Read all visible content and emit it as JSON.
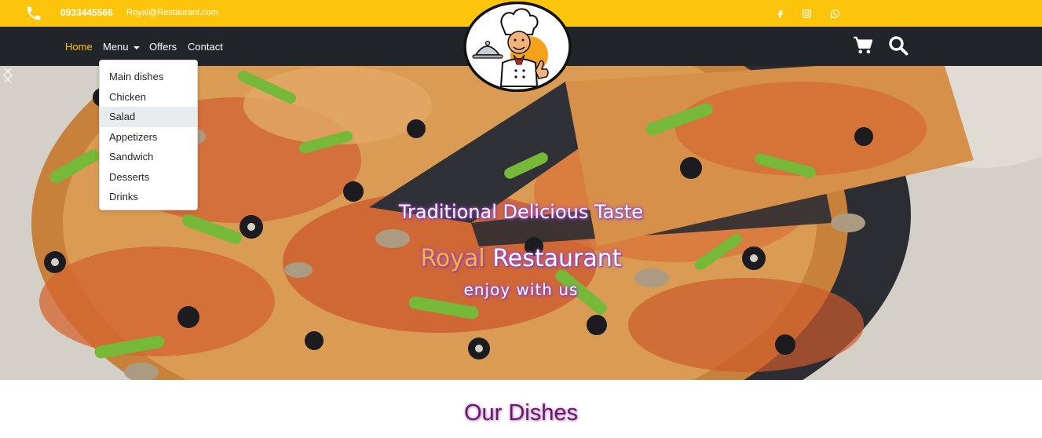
{
  "topbar": {
    "phone": "0933445566",
    "email": "Royal@Restaurant.com",
    "icons": [
      "phone-icon",
      "facebook-icon",
      "instagram-icon",
      "whatsapp-icon"
    ]
  },
  "nav": {
    "home": "Home",
    "menu": "Menu",
    "offers": "Offers",
    "contact": "Contact",
    "icons": [
      "cart-icon",
      "search-icon"
    ]
  },
  "dropdown": {
    "items": [
      "Main dishes",
      "Chicken",
      "Salad",
      "Appetizers",
      "Sandwich",
      "Desserts",
      "Drinks"
    ],
    "highlighted": "Salad"
  },
  "hero": {
    "tagline": "Traditional Delicious Taste",
    "brand_accent": "Royal",
    "brand_rest": "Restaurant",
    "subtitle": "enjoy with us"
  },
  "section": {
    "title": "Our Dishes"
  },
  "colors": {
    "accent": "#fdc40c",
    "navbar": "#212529",
    "title": "#6b1a5e"
  }
}
